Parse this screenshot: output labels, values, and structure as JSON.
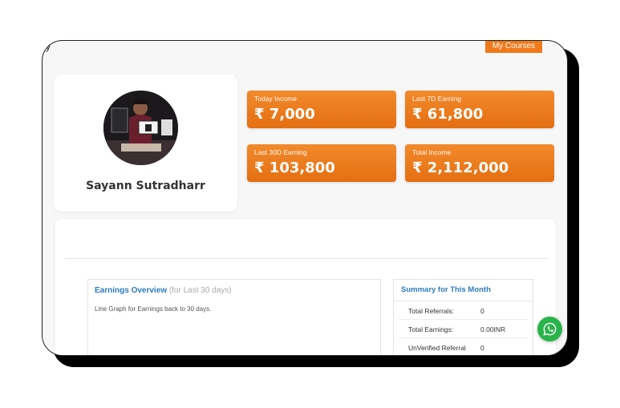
{
  "header": {
    "edge_glyph": "y",
    "my_courses_label": "My Courses"
  },
  "profile": {
    "name": "Sayann Sutradharr"
  },
  "stats": [
    {
      "label": "Today Income",
      "value": "₹ 7,000"
    },
    {
      "label": "Last 7D Earning",
      "value": "₹ 61,800"
    },
    {
      "label": "Last 30D Earning",
      "value": "₹ 103,800"
    },
    {
      "label": "Total Income",
      "value": "₹ 2,112,000"
    }
  ],
  "overview": {
    "title": "Earnings Overview",
    "subtitle": "(for Last 30 days)",
    "description": "Line Graph for Earnings back to 30 days."
  },
  "summary": {
    "title": "Summary for This Month",
    "rows": [
      {
        "label": "Total Referrals:",
        "value": "0"
      },
      {
        "label": "Total Earnings:",
        "value": "0.00INR"
      },
      {
        "label": "UnVerified Referral",
        "value": "0"
      }
    ]
  },
  "colors": {
    "accent": "#f07a1a",
    "link": "#2c7bbf",
    "whatsapp": "#29b44a"
  },
  "icons": {
    "chat": "whatsapp-icon"
  }
}
